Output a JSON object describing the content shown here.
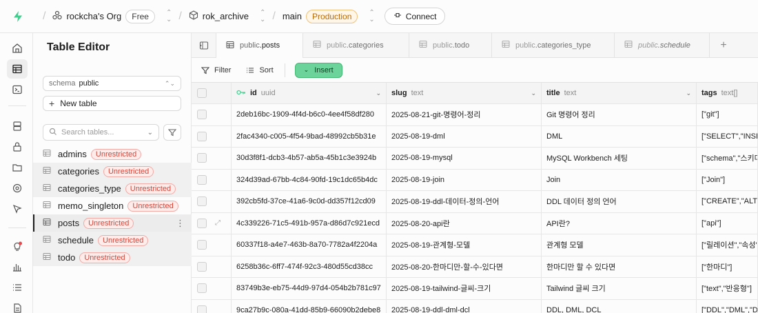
{
  "topbar": {
    "org": "rockcha's Org",
    "org_plan": "Free",
    "project": "rok_archive",
    "branch": "main",
    "branch_env": "Production",
    "connect_label": "Connect"
  },
  "sidebar": {
    "title": "Table Editor",
    "schema_label": "schema",
    "schema_value": "public",
    "new_table_label": "New table",
    "search_placeholder": "Search tables...",
    "tables": [
      {
        "name": "admins",
        "badge": "Unrestricted"
      },
      {
        "name": "categories",
        "badge": "Unrestricted"
      },
      {
        "name": "categories_type",
        "badge": "Unrestricted"
      },
      {
        "name": "memo_singleton",
        "badge": "Unrestricted"
      },
      {
        "name": "posts",
        "badge": "Unrestricted"
      },
      {
        "name": "schedule",
        "badge": "Unrestricted"
      },
      {
        "name": "todo",
        "badge": "Unrestricted"
      }
    ]
  },
  "tabs": [
    {
      "schema": "public",
      "table": "posts"
    },
    {
      "schema": "public",
      "table": "categories"
    },
    {
      "schema": "public",
      "table": "todo"
    },
    {
      "schema": "public",
      "table": "categories_type"
    },
    {
      "schema": "public",
      "table": "schedule"
    }
  ],
  "toolbar": {
    "filter_label": "Filter",
    "sort_label": "Sort",
    "insert_label": "Insert"
  },
  "grid": {
    "columns": [
      {
        "name": "id",
        "type": "uuid"
      },
      {
        "name": "slug",
        "type": "text"
      },
      {
        "name": "title",
        "type": "text"
      },
      {
        "name": "tags",
        "type": "text[]"
      }
    ],
    "rows": [
      [
        "2deb16bc-1909-4f4d-b6c0-4ee4f58df280",
        "2025-08-21-git-명령어-정리",
        "Git 명령어 정리",
        "[\"git\"]"
      ],
      [
        "2fac4340-c005-4f54-9bad-48992cb5b31e",
        "2025-08-19-dml",
        "DML",
        "[\"SELECT\",\"INSERT\""
      ],
      [
        "30d3f8f1-dcb3-4b57-ab5a-45b1c3e3924b",
        "2025-08-19-mysql",
        "MySQL Workbench 세팅",
        "[\"schema\",\"스키마\""
      ],
      [
        "324d39ad-67bb-4c84-90fd-19c1dc65b4dc",
        "2025-08-19-join",
        "Join",
        "[\"Join\"]"
      ],
      [
        "392cb5fd-37ce-41a6-9c0d-dd357f12cd09",
        "2025-08-19-ddl-데이터-정의-언어",
        "DDL 데이터 정의 언어",
        "[\"CREATE\",\"ALTER\""
      ],
      [
        "4c339226-71c5-491b-957a-d86d7c921ecd",
        "2025-08-20-api란",
        "API란?",
        "[\"api\"]"
      ],
      [
        "60337f18-a4e7-463b-8a70-7782a4f2204a",
        "2025-08-19-관계형-모델",
        "관계형 모델",
        "[\"릴레이션\",\"속성\""
      ],
      [
        "6258b36c-6ff7-474f-92c3-480d55cd38cc",
        "2025-08-20-한마디만-할-수-있다면",
        "한마디만 할 수 있다면",
        "[\"한마디\"]"
      ],
      [
        "83749b3e-eb75-44d9-97d4-054b2b781c97",
        "2025-08-19-tailwind-글씨-크기",
        "Tailwind 글씨 크기",
        "[\"text\",\"반응형\"]"
      ],
      [
        "9ca27b9c-080a-41dd-85b9-66090b2debe8",
        "2025-08-19-ddl-dml-dcl",
        "DDL, DML, DCL",
        "[\"DDL\",\"DML\",\"DCL\""
      ]
    ]
  }
}
